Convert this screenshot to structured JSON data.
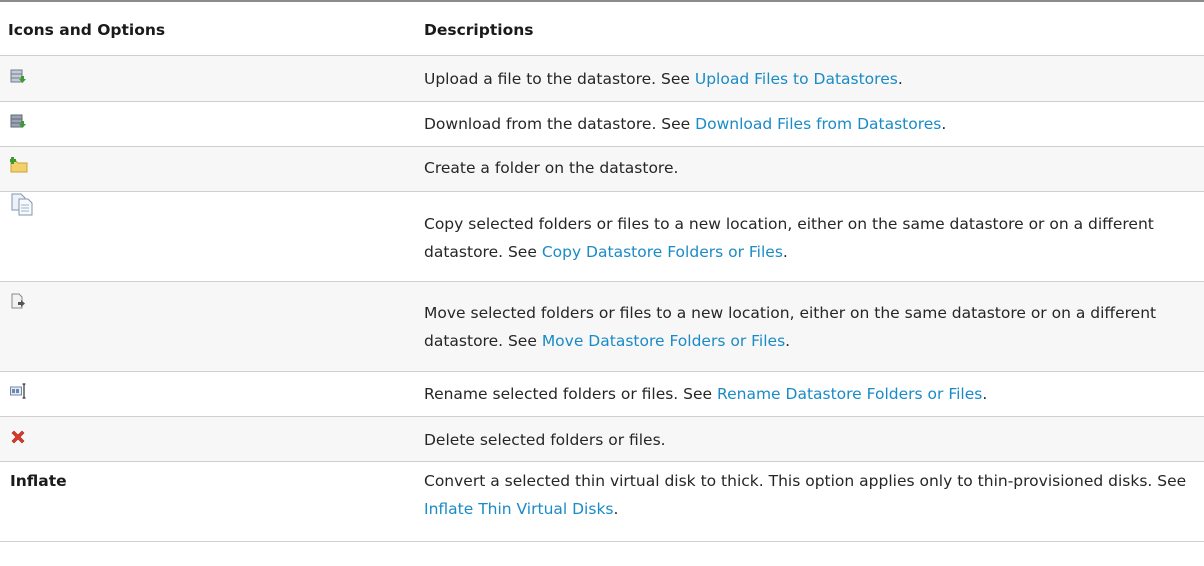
{
  "headers": {
    "col1": "Icons and Options",
    "col2": "Descriptions"
  },
  "rows": [
    {
      "icon": "upload-datastore-icon",
      "pre": "Upload a file to the datastore. See ",
      "link": "Upload Files to Datastores",
      "post": "."
    },
    {
      "icon": "download-datastore-icon",
      "pre": "Download from the datastore. See ",
      "link": "Download Files from Datastores",
      "post": "."
    },
    {
      "icon": "new-folder-icon",
      "pre": "Create a folder on the datastore.",
      "link": "",
      "post": ""
    },
    {
      "icon": "copy-files-icon",
      "pre": "Copy selected folders or files to a new location, either on the same datastore or on a different datastore. See ",
      "link": "Copy Datastore Folders or Files",
      "post": "."
    },
    {
      "icon": "move-files-icon",
      "pre": "Move selected folders or files to a new location, either on the same datastore or on a different datastore. See ",
      "link": "Move Datastore Folders or Files",
      "post": "."
    },
    {
      "icon": "rename-icon",
      "pre": "Rename selected folders or files. See ",
      "link": "Rename Datastore Folders or Files",
      "post": "."
    },
    {
      "icon": "delete-icon",
      "pre": "Delete selected folders or files.",
      "link": "",
      "post": ""
    },
    {
      "option": "Inflate",
      "pre": "Convert a selected thin virtual disk to thick. This option applies only to thin-provisioned disks. See ",
      "link": "Inflate Thin Virtual Disks",
      "post": "."
    }
  ],
  "colors": {
    "link": "#1a8bc6",
    "row_alt": "#f7f7f7",
    "rule": "#cfcfcf",
    "delete_red": "#d93a2b",
    "arrow_green": "#3f9b2f"
  }
}
